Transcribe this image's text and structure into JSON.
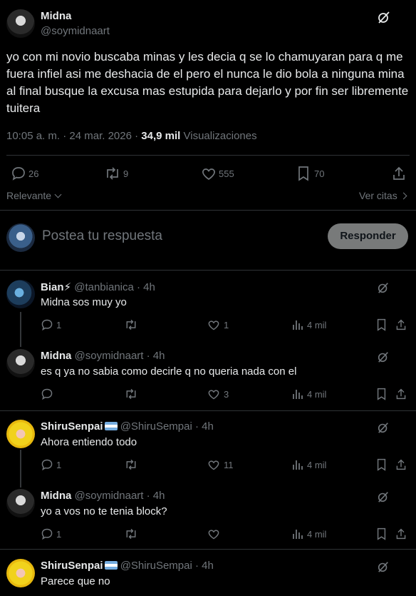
{
  "post": {
    "author_name": "Midna",
    "author_handle": "@soymidnaart",
    "text": "yo con mi novio buscaba minas y les decia q se lo chamuyaran para q me fuera infiel asi me deshacia de el pero el nunca le dio bola a ninguna mina al final busque la excusa mas estupida para dejarlo y por fin ser libremente tuitera",
    "time": "10:05 a. m. · 24 mar. 2026 ·",
    "views_count": "34,9 mil",
    "views_label": "Visualizaciones",
    "stats": {
      "replies": "26",
      "reposts": "9",
      "likes": "555",
      "bookmarks": "70"
    }
  },
  "sort": {
    "label": "Relevante",
    "quotes_label": "Ver citas"
  },
  "composer": {
    "placeholder": "Postea tu respuesta",
    "button": "Responder"
  },
  "replies": [
    {
      "name": "Bian⚡",
      "handle": "@tanbianica",
      "time": "· 4h",
      "text": "Midna sos muy yo",
      "replies": "1",
      "reposts": "",
      "likes": "1",
      "views": "4 mil",
      "avatar": "blue"
    },
    {
      "name": "Midna",
      "handle": "@soymidnaart",
      "time": "· 4h",
      "text": "es q ya no sabia como decirle q no queria nada con el",
      "replies": "",
      "reposts": "",
      "likes": "3",
      "views": "4 mil",
      "avatar": "dark"
    },
    {
      "name": "ShiruSenpai",
      "handle": "@ShiruSempai",
      "time": "· 4h",
      "text": "Ahora entiendo todo",
      "replies": "1",
      "reposts": "",
      "likes": "11",
      "views": "4 mil",
      "avatar": "yellow"
    },
    {
      "name": "Midna",
      "handle": "@soymidnaart",
      "time": "· 4h",
      "text": "yo a vos no te tenia block?",
      "replies": "1",
      "reposts": "",
      "likes": "",
      "views": "4 mil",
      "avatar": "dark"
    },
    {
      "name": "ShiruSenpai",
      "handle": "@ShiruSempai",
      "time": "· 4h",
      "text": "Parece que no",
      "replies": "",
      "reposts": "",
      "likes": "",
      "views": "",
      "avatar": "yellow"
    }
  ],
  "icons": {
    "grok": "grok-icon",
    "reply": "reply-icon",
    "repost": "repost-icon",
    "like": "heart-icon",
    "bookmark": "bookmark-icon",
    "share": "share-icon",
    "views": "views-icon",
    "flag": "argentina-flag-icon"
  }
}
